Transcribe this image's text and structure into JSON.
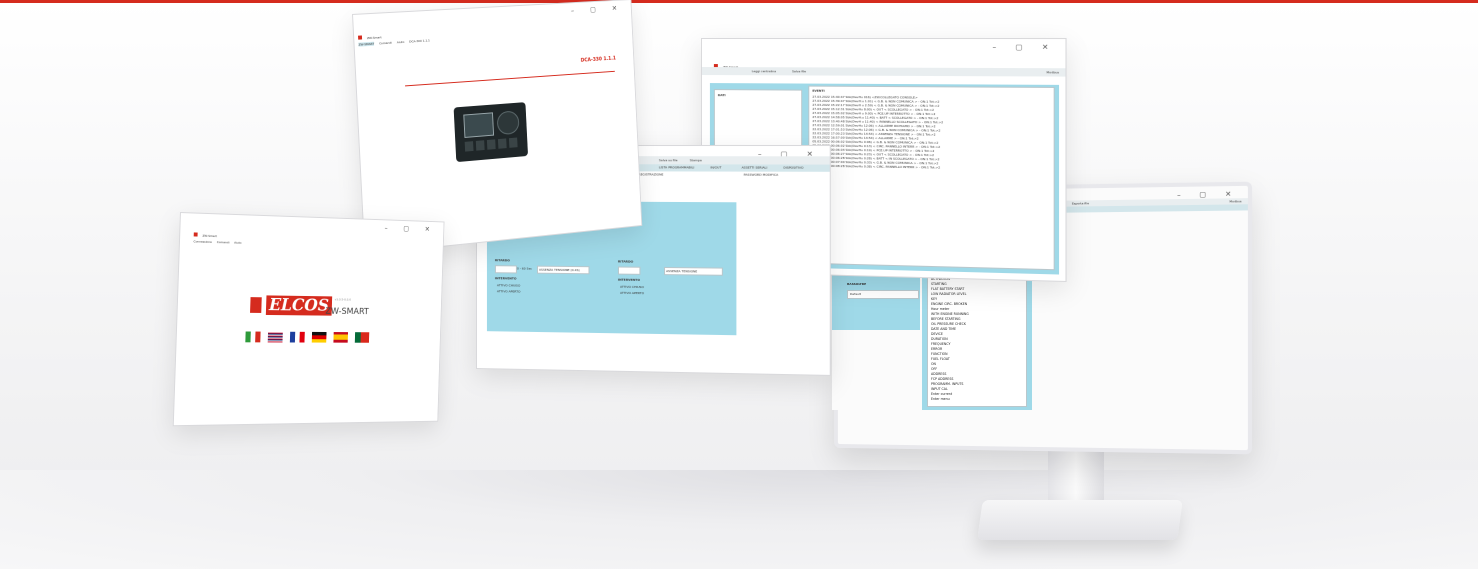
{
  "window_controls": "–  ▢  ✕",
  "win1": {
    "title": "ZW-Smart",
    "menu": [
      "Connessione",
      "Comandi",
      "Aiuto"
    ],
    "status_tabs": [
      "ZW-SMART",
      "DCA-300 1.1.1"
    ],
    "header": "DCA-330 1.1.1"
  },
  "win2": {
    "title": "ZW-Smart",
    "menu": [
      "Connessione",
      "Comandi",
      "Aiuto"
    ],
    "brand": "ELCOS",
    "brand_sub": "ZW-SMART",
    "version": "v1.0.5-0.0.0"
  },
  "win3": {
    "toolbar": [
      "Salva su file",
      "Stampa"
    ],
    "tabs": [
      "LISTA PROGRAMMABILI",
      "IN/OUT",
      "ASSETTI SERIALI",
      "DISPOSITIVO"
    ],
    "sub_tabs": [
      "REGISTRAZIONE",
      "PASSWORD MODIFICA"
    ],
    "sections": [
      "RITARDO",
      "INTERVENTO",
      "RITARDO",
      "INTERVENTO"
    ],
    "options": [
      "ATTIVO CHIUSO",
      "ATTIVO APERTO",
      "ATTIVO CHIUSO",
      "ATTIVO APERTO"
    ],
    "unit": "0 - 60 Sec",
    "fields": [
      "ASSENZA TENSIONE (0.4S)",
      "ASSENZA TENSIONE"
    ]
  },
  "win4": {
    "title": "ZW-Smart",
    "menu": [
      "Connessione",
      "Comandi",
      "Aiuto"
    ],
    "toolbar": [
      "Leggi centralina",
      "Salva file"
    ],
    "right_label": "Modbus",
    "left_title": "DATI",
    "events_title": "EVENTI",
    "events": [
      "27.03.2022 15:40:47 Sbk(DevHu 016) <ZW.COLLEGATO CONSOLE>",
      "27.03.2022 15:39:47 Sbk(DevH:u 1:01) < G.B. & NON COMUNICA > - ON:1 Tot:>2",
      "27.03.2022 15:22:17 Sbk(DevH u 2:59) < G.B. & NON COMUNICA > - ON:1 Tot:>2",
      "27.03.2022 15:12:31 Sbk(DevHu 8:00) < OUT < SCOLLEGATO > - ON:1 Tot:>2",
      "27.03.2022 15:05:02 Sbk(DevH u 9:00) < PCE.UP INTERROTTO > - ON:1 Tot:>2",
      "27.03.2022 14:58:05 Sbk(DevH:u 11:40) < BATT < SCOLLEGATO > - ON:1 Tot:>2",
      "27.03.2022 13:40:48 Sbk(DevH u 11:40) < PANNELLO SCOLLEGATO > - ON:1 Tot:>2",
      "27.03.2022 12:59:01 Sbk(DevHu 12:06) < ALLARME RICHIAMO > - ON:1 Tot:>2",
      "22.03.2022 17:01:53 Sbk(DevHu 12:06) < G.B. & NON COMUNICA > - ON:1 Tot:>2",
      "22.03.2022 17:00:23 Sbk(DevHu 14:54) < ASSENZA TENSIONE > - ON:1 Tot:>2",
      "22.03.2022 16:57:00 Sbk(DevHu 14:54) < ALLARME > - ON:1 Tot:>2",
      "05.03.2022 00:06:02 Sbk(DevHu 0:06) < G.B. & NON COMUNICA > - ON:1 Tot:>2",
      "05.03.2022 00:06:02 Sbk(DevHu 0:13) < CIRC. PANNELLO INTERR > - ON:1 Tot:>2",
      "05.03.2022 00:06:04 Sbk(DevHu 0:19) < PCE.UP INTERROTTO > - ON:1 Tot:>2",
      "05.03.2022 00:06:27 Sbk(DevHu 0:23) < OUT < SCOLLEGATO > - ON:1 Tot:>2",
      "05.03.2022 00:06:28 Sbk(DevHu 0:28) < BATT < IN SCOLLEGATO > - ON:1 Tot:>2",
      "05.03.2022 00:07:00 Sbk(DevHu 0:33) < G.B. & NON COMUNICA > - ON:1 Tot:>2",
      "05.03.2022 00:08:28 Sbk(DevHu 0:38) < CIRC. PANNELLO INTERR > - ON:1 Tot:>2"
    ]
  },
  "win5": {
    "toolbar": [
      "Esporta file"
    ],
    "right_label": "Modbus",
    "left_label": "BASSOLTRE",
    "input_value": "Default",
    "list": [
      "ACTIVATION",
      "STARTING",
      "FLAT BATTERY START",
      "LOW RADIATOR LEVEL",
      "KEY",
      "ENGINE CIRC. BROKEN",
      "Hour meter",
      "WITH ENGINE RUNNING",
      "BEFORE STARTING",
      "OIL PRESSURE CHECK",
      "DATE AND TIME",
      "DEVICE",
      "DURATION",
      "FREQUENCY",
      "ERROR",
      "FUNCTION",
      "FUEL FLOAT",
      "ON",
      "OFF",
      "ADDRESS",
      "FCP ADDRESS",
      "PROGRAMM. INPUTS",
      "INPUT CAL",
      "Enter current",
      "Enter menu"
    ]
  },
  "colors": {
    "accent_red": "#d52b1e",
    "panel_blue": "#9fd9e8",
    "toolbar_gray": "#e9eef0"
  }
}
